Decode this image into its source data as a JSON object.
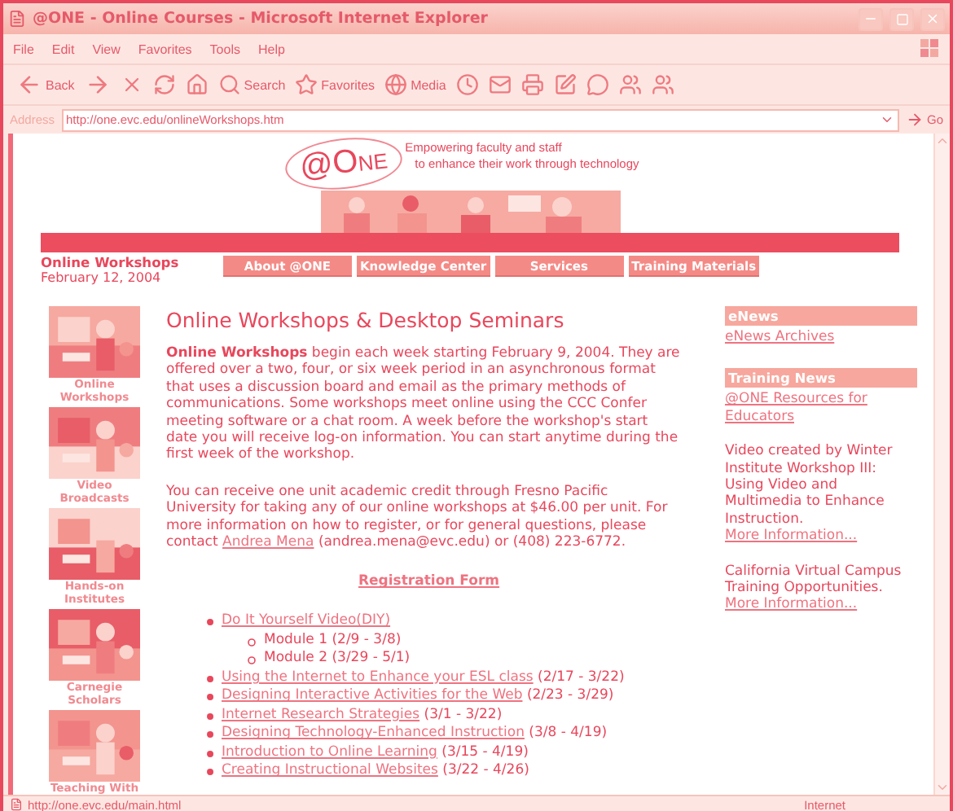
{
  "window": {
    "title": "@ONE - Online Courses - Microsoft Internet Explorer"
  },
  "menu": [
    "File",
    "Edit",
    "View",
    "Favorites",
    "Tools",
    "Help"
  ],
  "toolbar": [
    {
      "kind": "back",
      "label": "Back"
    },
    {
      "kind": "forward"
    },
    {
      "kind": "stop"
    },
    {
      "kind": "refresh"
    },
    {
      "kind": "home"
    },
    {
      "kind": "search",
      "label": "Search"
    },
    {
      "kind": "favorites",
      "label": "Favorites"
    },
    {
      "kind": "media",
      "label": "Media"
    },
    {
      "kind": "history"
    },
    {
      "kind": "mail"
    },
    {
      "kind": "print"
    },
    {
      "kind": "edit"
    },
    {
      "kind": "discuss"
    },
    {
      "kind": "messenger"
    },
    {
      "kind": "users"
    }
  ],
  "address": {
    "label": "Address",
    "value": "http://one.evc.edu/onlineWorkshops.htm",
    "go": "Go"
  },
  "page": {
    "logo": "@ONE",
    "tagline": [
      "Empowering faculty and staff",
      "to enhance their work through technology"
    ],
    "section_title": "Online Workshops",
    "date": "February 12, 2004",
    "nav": [
      "About @ONE",
      "Knowledge Center",
      "Services",
      "Training Materials"
    ],
    "programs": [
      {
        "caption": "Online Workshops"
      },
      {
        "caption": "Video Broadcasts"
      },
      {
        "caption": "Hands-on Institutes"
      },
      {
        "caption": "Carnegie Scholars"
      },
      {
        "caption": "Teaching With"
      }
    ],
    "heading": "Online Workshops & Desktop Seminars",
    "intro": "**Online Workshops** begin each week starting February 9, 2004. They are offered over a two, four, or six week period in an asynchronous format that uses a discussion board and email as the primary methods of communications. Some workshops meet online using the CCC Confer meeting software or a chat room. A week before the workshop's start date you will receive log-on information. You can start anytime during the first week of the workshop.",
    "credit": {
      "before": "You can receive one unit academic credit through Fresno Pacific University for taking any of our online workshops at $46.00 per unit. For more information on how to register, or for general questions, please contact",
      "link": "Andrea Mena",
      "after": "(andrea.mena@evc.edu) or (408) 223-6772."
    },
    "registration": "Registration Form",
    "workshops": [
      {
        "title": "Do It Yourself Video(DIY)",
        "children": [
          {
            "text": "Module 1 (2/9 - 3/8)"
          },
          {
            "text": "Module 2 (3/29 - 5/1)"
          }
        ]
      },
      {
        "title": "Using the Internet to Enhance your ESL class",
        "dates": "(2/17 - 3/22)"
      },
      {
        "title": "Designing Interactive Activities for the Web",
        "dates": "(2/23 - 3/29)"
      },
      {
        "title": "Internet Research Strategies",
        "dates": "(3/1 - 3/22)"
      },
      {
        "title": "Designing Technology-Enhanced Instruction",
        "dates": "(3/8 - 4/19)"
      },
      {
        "title": "Introduction to Online Learning",
        "dates": "(3/15 - 4/19)"
      },
      {
        "title": "Creating Instructional Websites",
        "dates": "(3/22 - 4/26)"
      }
    ],
    "sidebar": [
      {
        "header": "eNews",
        "items": [
          {
            "kind": "link",
            "text": "eNews Archives"
          }
        ]
      },
      {
        "header": "Training News",
        "items": [
          {
            "kind": "link",
            "text": "@ONE Resources for Educators"
          },
          {
            "kind": "note",
            "text": "Video created by Winter Institute Workshop III: Using Video and Multimedia to Enhance Instruction.",
            "link": "More Information..."
          },
          {
            "kind": "note",
            "text": "California Virtual Campus Training Opportunities.",
            "link": "More Information..."
          }
        ]
      }
    ]
  },
  "status_bar": {
    "url": "http://one.evc.edu/main.html",
    "zone": "Internet"
  }
}
